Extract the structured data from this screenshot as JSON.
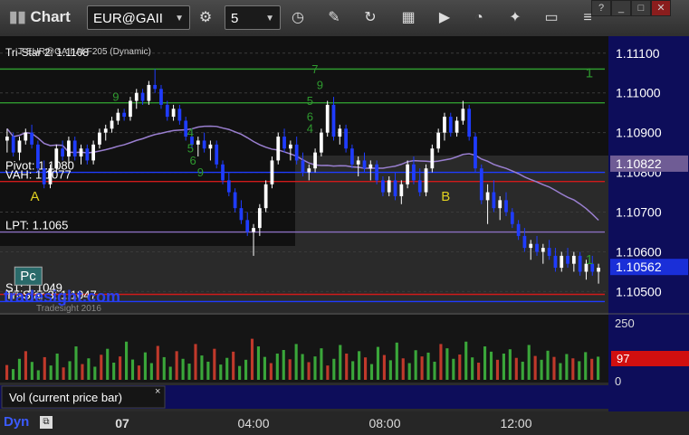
{
  "toolbar": {
    "title": "Chart",
    "symbol": "EUR@GAII",
    "interval": "5",
    "window_controls": [
      "?",
      "_",
      "□",
      "✕"
    ]
  },
  "chart_data": [
    {
      "type": "candlestick",
      "study_label": "Tri-Star 2: 1.1108",
      "overlay_label": "T-EUR@GAII-Al-F205 (Dynamic)",
      "ylim": [
        1.1046,
        1.1112
      ],
      "yticks": [
        "1.11100",
        "1.11000",
        "1.10900",
        "1.10800",
        "1.10700",
        "1.10600",
        "1.10500"
      ],
      "xticks": [
        "07",
        "04:00",
        "08:00",
        "12:00"
      ],
      "last_price": "1.10562",
      "ma_value": "1.10822",
      "colors": {
        "up": "#ffffff",
        "down": "#1f3cff",
        "ma": "#9a7fd0",
        "last": "#1a2fd8",
        "ma_tag": "#6f5c95"
      },
      "levels": [
        {
          "label": "Tri-Star 2: 1.1108",
          "value": 1.1106,
          "color": "#2f9a2f"
        },
        {
          "label": "",
          "value": 1.10975,
          "color": "#2f9a2f"
        },
        {
          "label": "Pivot: 1.1080",
          "value": 1.108,
          "color": "#1f3cff"
        },
        {
          "label": "VAH: 1.1077",
          "value": 1.10777,
          "color": "#d01b1b"
        },
        {
          "label": "LPT: 1.1065",
          "value": 1.1065,
          "color": "#8a6fc0"
        },
        {
          "label": "S1: 1.1049",
          "value": 1.10493,
          "color": "#d01b1b"
        },
        {
          "label": "Tri-Star 3: 1.1047",
          "value": 1.10475,
          "color": "#1f3cff"
        }
      ],
      "visible_level_text": [
        "Pivot: 1.1080",
        "VAH: 1.1077",
        "LPT: 1.1065",
        "S1: 1.1049",
        "Tri-Star 3: 1.1047"
      ],
      "annotations": [
        {
          "text": "A",
          "x": 10,
          "y": 1.1077
        },
        {
          "text": "B",
          "x": 175,
          "y": 1.1077
        },
        {
          "text": "1",
          "x": 233,
          "y": 1.1108
        },
        {
          "text": "1",
          "x": 233,
          "y": 1.1061
        },
        {
          "text": "Pc",
          "x": 3,
          "y": 1.1053
        }
      ],
      "setup_numbers": [
        {
          "text": "9",
          "x": 43,
          "y": 1.1098
        },
        {
          "text": "7",
          "x": 123,
          "y": 1.1105
        },
        {
          "text": "9",
          "x": 125,
          "y": 1.1101
        },
        {
          "text": "5",
          "x": 121,
          "y": 1.1097
        },
        {
          "text": "6",
          "x": 121,
          "y": 1.1093
        },
        {
          "text": "4",
          "x": 121,
          "y": 1.109
        },
        {
          "text": "4",
          "x": 73,
          "y": 1.1089
        },
        {
          "text": "5",
          "x": 73,
          "y": 1.1085
        },
        {
          "text": "6",
          "x": 74,
          "y": 1.1082
        },
        {
          "text": "9",
          "x": 77,
          "y": 1.1079
        }
      ],
      "watermark": "tradesight.com",
      "watermark_date": "Tradesight 2016",
      "candles": [
        [
          1.1088,
          1.1091,
          1.1085,
          1.1089
        ],
        [
          1.1089,
          1.109,
          1.1084,
          1.1085
        ],
        [
          1.1085,
          1.1089,
          1.1083,
          1.1088
        ],
        [
          1.1088,
          1.1091,
          1.1087,
          1.109
        ],
        [
          1.109,
          1.1092,
          1.1086,
          1.1087
        ],
        [
          1.1087,
          1.1088,
          1.108,
          1.1081
        ],
        [
          1.1081,
          1.1083,
          1.1076,
          1.1077
        ],
        [
          1.1077,
          1.1082,
          1.1076,
          1.1081
        ],
        [
          1.1081,
          1.1087,
          1.108,
          1.1086
        ],
        [
          1.1086,
          1.1088,
          1.1083,
          1.1084
        ],
        [
          1.1084,
          1.1089,
          1.1082,
          1.1088
        ],
        [
          1.1088,
          1.1089,
          1.1083,
          1.1084
        ],
        [
          1.1084,
          1.1087,
          1.1082,
          1.1086
        ],
        [
          1.1086,
          1.1087,
          1.1082,
          1.1083
        ],
        [
          1.1083,
          1.1088,
          1.1082,
          1.1087
        ],
        [
          1.1087,
          1.1091,
          1.1086,
          1.109
        ],
        [
          1.109,
          1.1092,
          1.1088,
          1.1091
        ],
        [
          1.1091,
          1.1094,
          1.109,
          1.1093
        ],
        [
          1.1093,
          1.1096,
          1.1092,
          1.1095
        ],
        [
          1.1095,
          1.1096,
          1.1093,
          1.1094
        ],
        [
          1.1094,
          1.1099,
          1.1093,
          1.1098
        ],
        [
          1.1098,
          1.1101,
          1.1096,
          1.11
        ],
        [
          1.11,
          1.1101,
          1.1097,
          1.1098
        ],
        [
          1.1098,
          1.1103,
          1.1097,
          1.1102
        ],
        [
          1.1102,
          1.1106,
          1.11,
          1.1101
        ],
        [
          1.1101,
          1.1102,
          1.1096,
          1.1097
        ],
        [
          1.1097,
          1.1098,
          1.1093,
          1.1094
        ],
        [
          1.1094,
          1.1097,
          1.1093,
          1.1096
        ],
        [
          1.1096,
          1.1097,
          1.1092,
          1.1093
        ],
        [
          1.1093,
          1.1094,
          1.1088,
          1.1089
        ],
        [
          1.1089,
          1.1091,
          1.1086,
          1.1087
        ],
        [
          1.1087,
          1.1089,
          1.1084,
          1.1088
        ],
        [
          1.1088,
          1.109,
          1.1085,
          1.1086
        ],
        [
          1.1086,
          1.1088,
          1.1083,
          1.1087
        ],
        [
          1.1087,
          1.1088,
          1.1081,
          1.1082
        ],
        [
          1.1082,
          1.1083,
          1.1077,
          1.1078
        ],
        [
          1.1078,
          1.108,
          1.1074,
          1.1075
        ],
        [
          1.1075,
          1.1076,
          1.107,
          1.1071
        ],
        [
          1.1071,
          1.1073,
          1.1067,
          1.1068
        ],
        [
          1.1068,
          1.107,
          1.1064,
          1.1065
        ],
        [
          1.1065,
          1.1067,
          1.1059,
          1.1066
        ],
        [
          1.1066,
          1.1072,
          1.1064,
          1.1071
        ],
        [
          1.1071,
          1.1078,
          1.107,
          1.1077
        ],
        [
          1.1077,
          1.1084,
          1.1076,
          1.1083
        ],
        [
          1.1083,
          1.109,
          1.1082,
          1.1089
        ],
        [
          1.1089,
          1.1091,
          1.1085,
          1.1086
        ],
        [
          1.1086,
          1.1088,
          1.1083,
          1.1087
        ],
        [
          1.1087,
          1.1089,
          1.1082,
          1.1083
        ],
        [
          1.1083,
          1.1085,
          1.1079,
          1.108
        ],
        [
          1.108,
          1.1082,
          1.1078,
          1.1081
        ],
        [
          1.1081,
          1.1086,
          1.108,
          1.1085
        ],
        [
          1.1085,
          1.1091,
          1.1084,
          1.109
        ],
        [
          1.109,
          1.1098,
          1.1089,
          1.1097
        ],
        [
          1.1097,
          1.1099,
          1.1088,
          1.1089
        ],
        [
          1.1089,
          1.1092,
          1.1087,
          1.1091
        ],
        [
          1.1091,
          1.1092,
          1.1085,
          1.1086
        ],
        [
          1.1086,
          1.1087,
          1.1081,
          1.1082
        ],
        [
          1.1082,
          1.1084,
          1.1079,
          1.1083
        ],
        [
          1.1083,
          1.1085,
          1.108,
          1.1081
        ],
        [
          1.1081,
          1.1083,
          1.1078,
          1.1082
        ],
        [
          1.1082,
          1.1083,
          1.1077,
          1.1078
        ],
        [
          1.1078,
          1.1079,
          1.1074,
          1.1075
        ],
        [
          1.1075,
          1.1079,
          1.1074,
          1.1078
        ],
        [
          1.1078,
          1.108,
          1.1073,
          1.1074
        ],
        [
          1.1074,
          1.1078,
          1.1072,
          1.1077
        ],
        [
          1.1077,
          1.1083,
          1.1076,
          1.1082
        ],
        [
          1.1082,
          1.1084,
          1.1077,
          1.1078
        ],
        [
          1.1078,
          1.1081,
          1.1074,
          1.1075
        ],
        [
          1.1075,
          1.1082,
          1.1074,
          1.1081
        ],
        [
          1.1081,
          1.1087,
          1.108,
          1.1086
        ],
        [
          1.1086,
          1.1091,
          1.1085,
          1.109
        ],
        [
          1.109,
          1.1095,
          1.1088,
          1.1094
        ],
        [
          1.1094,
          1.1095,
          1.1089,
          1.109
        ],
        [
          1.109,
          1.1094,
          1.1089,
          1.1093
        ],
        [
          1.1093,
          1.1098,
          1.1092,
          1.1096
        ],
        [
          1.1096,
          1.1097,
          1.1088,
          1.1089
        ],
        [
          1.1089,
          1.109,
          1.108,
          1.1081
        ],
        [
          1.1081,
          1.1082,
          1.1072,
          1.1073
        ],
        [
          1.1073,
          1.1077,
          1.1067,
          1.1075
        ],
        [
          1.1075,
          1.1078,
          1.107,
          1.1071
        ],
        [
          1.1071,
          1.1074,
          1.1068,
          1.1073
        ],
        [
          1.1073,
          1.1075,
          1.1069,
          1.107
        ],
        [
          1.107,
          1.1071,
          1.1066,
          1.1067
        ],
        [
          1.1067,
          1.1068,
          1.1063,
          1.1064
        ],
        [
          1.1064,
          1.1066,
          1.106,
          1.1061
        ],
        [
          1.1061,
          1.1063,
          1.1058,
          1.1062
        ],
        [
          1.1062,
          1.1064,
          1.1059,
          1.106
        ],
        [
          1.106,
          1.1062,
          1.1057,
          1.1061
        ],
        [
          1.1061,
          1.1063,
          1.1058,
          1.1059
        ],
        [
          1.1059,
          1.1061,
          1.1055,
          1.1056
        ],
        [
          1.1056,
          1.106,
          1.1055,
          1.1059
        ],
        [
          1.1059,
          1.1061,
          1.1056,
          1.1057
        ],
        [
          1.1057,
          1.106,
          1.1055,
          1.1059
        ],
        [
          1.1059,
          1.106,
          1.1054,
          1.1055
        ],
        [
          1.1055,
          1.1058,
          1.1053,
          1.1057
        ],
        [
          1.1057,
          1.1059,
          1.1054,
          1.1055
        ],
        [
          1.1055,
          1.1057,
          1.1052,
          1.1056
        ]
      ],
      "volume": {
        "yticks": [
          "250",
          "0"
        ],
        "last_value": "97",
        "ymax": 250,
        "bars": [
          62,
          45,
          88,
          120,
          75,
          40,
          95,
          60,
          110,
          52,
          78,
          140,
          66,
          90,
          55,
          105,
          130,
          72,
          98,
          160,
          85,
          60,
          115,
          70,
          142,
          95,
          55,
          120,
          88,
          68,
          150,
          102,
          76,
          130,
          64,
          92,
          118,
          58,
          84,
          172,
          140,
          96,
          70,
          110,
          125,
          86,
          150,
          108,
          74,
          98,
          132,
          60,
          88,
          146,
          110,
          78,
          120,
          94,
          66,
          138,
          104,
          82,
          156,
          90,
          70,
          124,
          98,
          114,
          76,
          150,
          132,
          88,
          106,
          160,
          94,
          72,
          140,
          118,
          84,
          110,
          128,
          92,
          76,
          146,
          100,
          84,
          122,
          96,
          70,
          108,
          90,
          78,
          116,
          88,
          97
        ],
        "colors": [
          "#3aa63a",
          "#c0392b"
        ]
      },
      "volume_label": "Vol (current price bar)"
    }
  ],
  "status": {
    "left": "Dyn"
  }
}
